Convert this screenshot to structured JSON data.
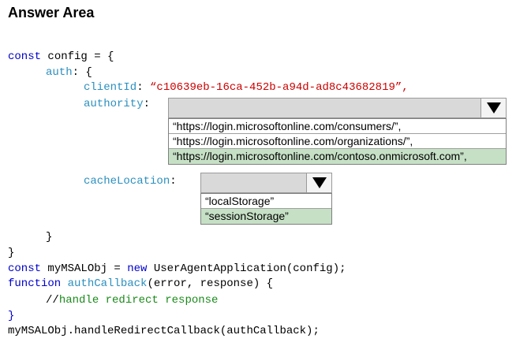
{
  "title": "Answer Area",
  "code": {
    "l1_kw": "const",
    "l1_rest": " config = {",
    "l2_prop": "auth",
    "l2_rest": ": {",
    "l3_prop": "clientId",
    "l3_colon": ": ",
    "l3_str": "“c10639eb-16ca-452b-a94d-ad8c43682819”,",
    "l4_prop": "authority",
    "l4_colon": ":",
    "l5_prop": "cacheLocation",
    "l5_colon": ":",
    "l6": "}",
    "l7": "}",
    "l8_kw1": "const",
    "l8_mid": " myMSALObj = ",
    "l8_kw2": "new",
    "l8_rest": " UserAgentApplication(config);",
    "l9_kw": "function",
    "l9_fn": " authCallback",
    "l9_rest": "(error, response) {",
    "l10_slashes": "//",
    "l10_comment": "handle redirect response",
    "l11": "}",
    "l12": "myMSALObj.handleRedirectCallback(authCallback);"
  },
  "authority_dropdown": {
    "options": [
      "“https://login.microsoftonline.com/consumers/”,",
      "“https://login.microsoftonline.com/organizations/”,",
      "“https://login.microsoftonline.com/contoso.onmicrosoft.com”,"
    ],
    "selected_index": 2
  },
  "cache_dropdown": {
    "options": [
      "“localStorage”",
      "“sessionStorage”"
    ],
    "selected_index": 1
  },
  "colors": {
    "keyword": "#0000cc",
    "property": "#2a8fbf",
    "string": "#cc0000",
    "comment": "#1a8a1a",
    "selected_option": "#c6e0c6"
  },
  "icons": {
    "dropdown_arrow": "triangle-down-icon"
  }
}
